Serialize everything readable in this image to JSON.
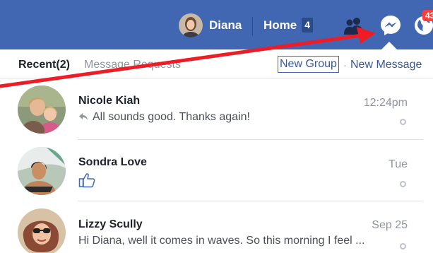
{
  "topbar": {
    "user_name": "Diana",
    "home_label": "Home",
    "home_count": "4",
    "notification_count": "43",
    "icons": [
      "friends-icon",
      "messenger-icon",
      "globe-icon"
    ],
    "bg_color": "#4267b2"
  },
  "header": {
    "recent_label": "Recent",
    "recent_count": "(2)",
    "requests_label": "Message Requests",
    "separator": "·",
    "new_group_label": "New Group",
    "new_message_label": "New Message"
  },
  "threads": [
    {
      "name": "Nicole Kiah",
      "snippet": "All sounds good. Thanks again!",
      "time": "12:24pm",
      "reply_icon": "reply-icon"
    },
    {
      "name": "Sondra Love",
      "snippet": "",
      "time": "Tue",
      "snippet_icon": "thumbs-up-icon"
    },
    {
      "name": "Lizzy Scully",
      "snippet": "Hi Diana, well it comes in waves. So this morning I feel ...",
      "time": "Sep 25"
    }
  ],
  "annotation": {
    "arrow_color": "#ee1c24"
  }
}
